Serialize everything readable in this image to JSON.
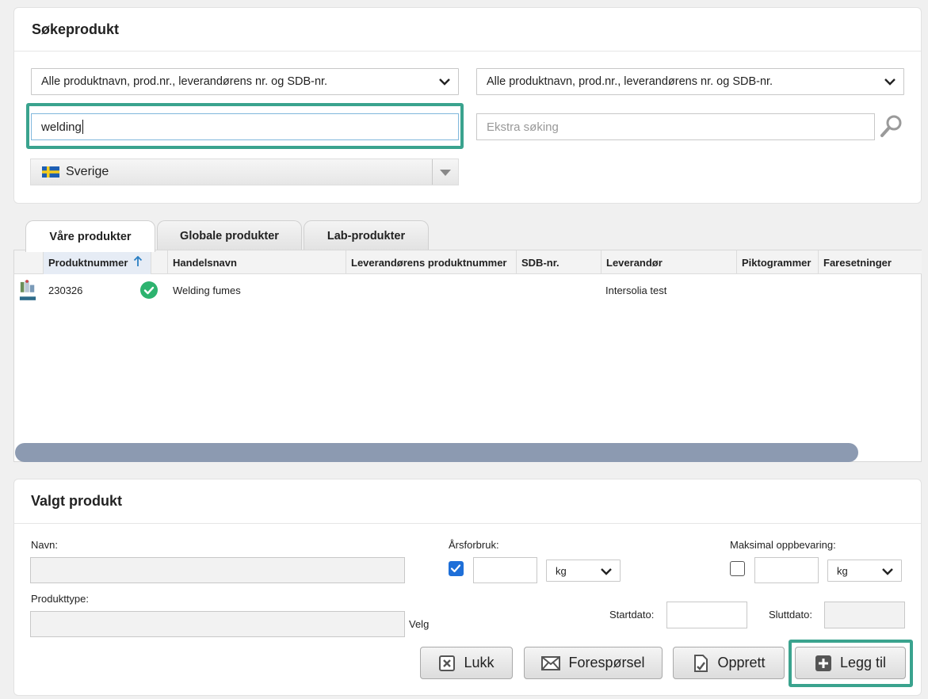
{
  "search_panel": {
    "title": "Søkeprodukt",
    "select_left": "Alle produktnavn, prod.nr., leverandørens nr. og SDB-nr.",
    "select_right": "Alle produktnavn, prod.nr., leverandørens nr. og SDB-nr.",
    "search_value": "welding",
    "extra_placeholder": "Ekstra søking",
    "country": "Sverige"
  },
  "tabs": [
    {
      "label": "Våre produkter"
    },
    {
      "label": "Globale produkter"
    },
    {
      "label": "Lab-produkter"
    }
  ],
  "grid": {
    "columns": [
      "Produktnummer",
      "Handelsnavn",
      "Leverandørens produktnummer",
      "SDB-nr.",
      "Leverandør",
      "Piktogrammer",
      "Faresetninger"
    ],
    "rows": [
      {
        "produktnummer": "230326",
        "handelsnavn": "Welding fumes",
        "leverandor_nr": "",
        "sdb": "",
        "leverandor": "Intersolia test"
      }
    ]
  },
  "selected_panel": {
    "title": "Valgt produkt",
    "navn_label": "Navn:",
    "produkttype_label": "Produkttype:",
    "velg": "Velg",
    "arsforbruk_label": "Årsforbruk:",
    "arsforbruk_unit": "kg",
    "maks_label": "Maksimal oppbevaring:",
    "maks_unit": "kg",
    "startdato_label": "Startdato:",
    "sluttdato_label": "Sluttdato:"
  },
  "buttons": {
    "lukk": "Lukk",
    "foresporsel": "Forespørsel",
    "opprett": "Opprett",
    "legg_til": "Legg til"
  },
  "colors": {
    "highlight": "#3aa38e",
    "checkbox_on": "#1e6fd8",
    "status_ok": "#2db36f",
    "scrollbar": "#8c9ab1"
  }
}
